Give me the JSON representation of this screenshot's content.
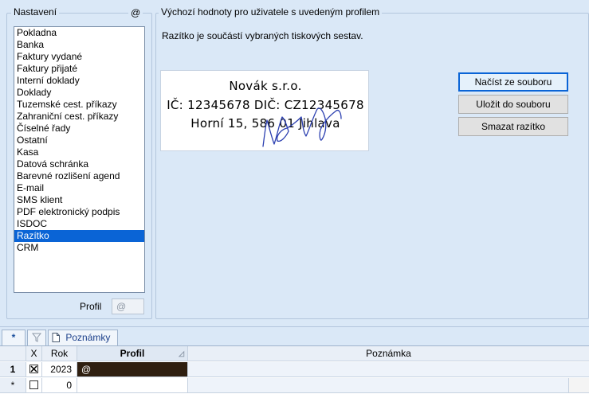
{
  "left_group": {
    "title": "Nastavení",
    "at_icon": "@",
    "items": [
      "Pokladna",
      "Banka",
      "Faktury vydané",
      "Faktury přijaté",
      "Interní doklady",
      "Doklady",
      "Tuzemské cest. příkazy",
      "Zahraniční cest. příkazy",
      "Číselné řady",
      "Ostatní",
      "Kasa",
      "Datová schránka",
      "Barevné rozlišení agend",
      "E-mail",
      "SMS klient",
      "PDF elektronický podpis",
      "ISDOC",
      "Razítko",
      "CRM"
    ],
    "selected_index": 17,
    "profile_label": "Profil",
    "profile_value": "@"
  },
  "right_group": {
    "title": "Výchozí hodnoty pro uživatele s uvedeným profilem",
    "description": "Razítko je součástí vybraných tiskových sestav.",
    "stamp": {
      "line1": "Novák s.r.o.",
      "line2": "IČ: 12345678 DIČ: CZ12345678",
      "line3": "Horní 15, 586 01 Jihlava",
      "signature_color": "#2b3fb0"
    },
    "buttons": {
      "load": "Načíst ze souboru",
      "save": "Uložit do souboru",
      "delete": "Smazat razítko"
    }
  },
  "bottom_tabs": {
    "star": "*",
    "filter_icon": "filter-icon",
    "notes_label": "Poznámky"
  },
  "grid": {
    "columns": {
      "x": "X",
      "rok": "Rok",
      "profil": "Profil",
      "poznamka": "Poznámka"
    },
    "rows": [
      {
        "header": "1",
        "checked": true,
        "rok": "2023",
        "profil": "@",
        "poznamka": ""
      },
      {
        "header": "*",
        "checked": false,
        "rok": "0",
        "profil": "",
        "poznamka": ""
      }
    ],
    "selected_cell_color": "#2f1f10"
  }
}
